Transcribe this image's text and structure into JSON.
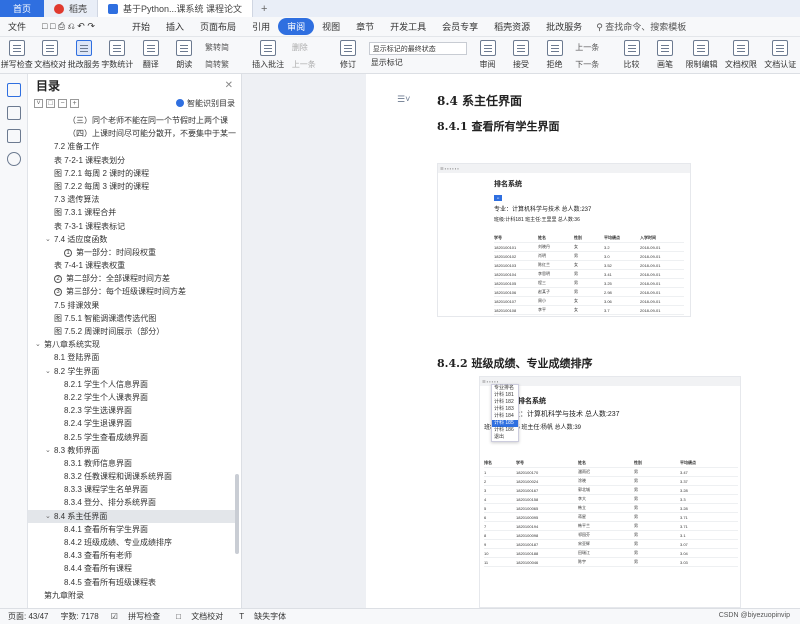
{
  "tabs": {
    "home": "首页",
    "t1": "稻壳",
    "t2": "基于Python...课系统 课程论文",
    "plus": "+"
  },
  "menu": [
    "开始",
    "插入",
    "页面布局",
    "引用",
    "审阅",
    "视图",
    "章节",
    "开发工具",
    "会员专享",
    "稻壳资源",
    "批改服务"
  ],
  "menu_file": "文件",
  "menu_selected_index": 4,
  "menu_search": "查找命令、搜索模板",
  "ribbon": {
    "buttons": [
      "拼写检查",
      "文档校对",
      "批改服务",
      "字数统计",
      "翻译",
      "朗读"
    ],
    "convert": [
      "繁转简",
      "简转繁"
    ],
    "insert_comment": "插入批注",
    "comment_ops": [
      "删除",
      "上一条",
      "下一条"
    ],
    "revise": "修订",
    "state_select": "显示标记的最终状态",
    "show_marks": "显示标记",
    "review": "审阅",
    "accept": "接受",
    "reject": "拒绝",
    "prev": "上一条",
    "next": "下一条",
    "compare": "比较",
    "pen": "画笔",
    "restrict": "限制编辑",
    "permission": "文档权限",
    "auth": "文档认证"
  },
  "toc": {
    "title": "目录",
    "smart": "智能识别目录",
    "items": [
      {
        "t": "（三）同个老师不能在同一个节假时上两个课​",
        "lvl": 3,
        "sel": false
      },
      {
        "t": "（四）上课时间尽可能分散开，不要集中于某一...",
        "lvl": 3,
        "sel": false
      },
      {
        "t": "7.2  准备工作",
        "lvl": 1,
        "sel": false
      },
      {
        "t": "表 7-2-1  课程表划分",
        "lvl": 1,
        "sel": false
      },
      {
        "t": "图 7.2.1  每周 2 课时的课程",
        "lvl": 1,
        "sel": false
      },
      {
        "t": "图 7.2.2  每周 3 课时的课程",
        "lvl": 1,
        "sel": false
      },
      {
        "t": "7.3  遗传算法",
        "lvl": 1,
        "sel": false
      },
      {
        "t": "图 7.3.1  课程合并",
        "lvl": 1,
        "sel": false
      },
      {
        "t": "表 7-3-1  课程表标记",
        "lvl": 1,
        "sel": false
      },
      {
        "t": "7.4  适应度函数",
        "lvl": 1,
        "sel": false,
        "arrow": "v"
      },
      {
        "t": "第一部分：时间段权重",
        "lvl": 2,
        "sel": false,
        "circ": "1"
      },
      {
        "t": "表 7-4-1  课程表权重",
        "lvl": 1,
        "sel": false
      },
      {
        "t": "第二部分：全部课程时间方差",
        "lvl": 1,
        "sel": false,
        "circ": "2"
      },
      {
        "t": "第三部分：每个班级课程时间方差",
        "lvl": 1,
        "sel": false,
        "circ": "3"
      },
      {
        "t": "7.5  排课效果",
        "lvl": 1,
        "sel": false
      },
      {
        "t": "图 7.5.1  智能调课遗传选代图",
        "lvl": 1,
        "sel": false
      },
      {
        "t": "图 7.5.2  周课时间展示（部分）",
        "lvl": 1,
        "sel": false
      },
      {
        "t": "第八章系统实现",
        "lvl": 0,
        "sel": false,
        "arrow": "v"
      },
      {
        "t": "8.1  登陆界面",
        "lvl": 1,
        "sel": false
      },
      {
        "t": "8.2  学生界面",
        "lvl": 1,
        "sel": false,
        "arrow": "v"
      },
      {
        "t": "8.2.1  学生个人信息界面",
        "lvl": 2,
        "sel": false
      },
      {
        "t": "8.2.2  学生个人课表界面",
        "lvl": 2,
        "sel": false
      },
      {
        "t": "8.2.3  学生选课界面",
        "lvl": 2,
        "sel": false
      },
      {
        "t": "8.2.4  学生退课界面",
        "lvl": 2,
        "sel": false
      },
      {
        "t": "8.2.5  学生查看成绩界面",
        "lvl": 2,
        "sel": false
      },
      {
        "t": "8.3  教师界面",
        "lvl": 1,
        "sel": false,
        "arrow": "v"
      },
      {
        "t": "8.3.1  教师信息界面",
        "lvl": 2,
        "sel": false
      },
      {
        "t": "8.3.2  任教课程和调课系统界面",
        "lvl": 2,
        "sel": false
      },
      {
        "t": "8.3.3  课程学生名单界面",
        "lvl": 2,
        "sel": false
      },
      {
        "t": "8.3.4  登分、排分系统界面",
        "lvl": 2,
        "sel": false
      },
      {
        "t": "8.4  系主任界面",
        "lvl": 1,
        "sel": true,
        "arrow": "v"
      },
      {
        "t": "8.4.1  查看所有学生界面",
        "lvl": 2,
        "sel": false
      },
      {
        "t": "8.4.2  班级成绩、专业成绩排序",
        "lvl": 2,
        "sel": false
      },
      {
        "t": "8.4.3  查看所有老师",
        "lvl": 2,
        "sel": false
      },
      {
        "t": "8.4.4  查看所有课程",
        "lvl": 2,
        "sel": false
      },
      {
        "t": "8.4.5  查看所有班级课程表",
        "lvl": 2,
        "sel": false
      },
      {
        "t": "第九章附录",
        "lvl": 0,
        "sel": false
      }
    ]
  },
  "doc": {
    "h_84": "8.4  系主任界面",
    "h_841": "8.4.1  查看所有学生界面",
    "h_842": "8.4.2  班级成绩、专业成绩排序",
    "shot1": {
      "title": "排名系统",
      "major": "专业：计算机科学与技术 总人数:237",
      "cls": "班级:计科181 班主任:王里里 总人数:36",
      "headers": [
        "学号",
        "姓名",
        "性别",
        "平均绩点",
        "入学时间"
      ],
      "rows": [
        [
          "1820100101",
          "刘晓丹",
          "女",
          "3.2",
          "2018-09-01"
        ],
        [
          "1820100102",
          "肖明",
          "男",
          "3.0",
          "2018-09-01"
        ],
        [
          "1820100103",
          "陈红兰",
          "女",
          "3.52",
          "2018-09-01"
        ],
        [
          "1820100104",
          "李思明",
          "男",
          "3.41",
          "2018-09-01"
        ],
        [
          "1820100105",
          "程三",
          "男",
          "3.25",
          "2018-09-01"
        ],
        [
          "1820100106",
          "赵某子",
          "男",
          "2.98",
          "2018-09-01"
        ],
        [
          "1820100107",
          "周小",
          "女",
          "3.06",
          "2018-09-01"
        ],
        [
          "1820100108",
          "李平",
          "女",
          "3.7",
          "2018-09-01"
        ]
      ]
    },
    "shot2": {
      "title": "排名系统",
      "major": "专业：计算机科学与技术 总人数:237",
      "cls": "班级:计科185 班主任:杨帆 总人数:39",
      "headers": [
        "排名",
        "学号",
        "姓名",
        "性别",
        "平均绩点"
      ],
      "rows": [
        [
          "1",
          "1820100170",
          "潘雨迟",
          "男",
          "3.47"
        ],
        [
          "2",
          "1820100024",
          "涂晓",
          "男",
          "3.37"
        ],
        [
          "3",
          "1820100167",
          "郭北城",
          "男",
          "3.28"
        ],
        [
          "4",
          "1820100158",
          "李大",
          "男",
          "3.3"
        ],
        [
          "5",
          "1820100065",
          "韩立",
          "男",
          "3.28"
        ],
        [
          "6",
          "1820100095",
          "蒋星",
          "男",
          "3.71"
        ],
        [
          "7",
          "1820100194",
          "韩平兰",
          "男",
          "3.71"
        ],
        [
          "8",
          "1820100098",
          "祁园芬",
          "男",
          "3.1"
        ],
        [
          "9",
          "1820100187",
          "宋亚辉",
          "男",
          "3.07"
        ],
        [
          "10",
          "1820100188",
          "田瑞江",
          "男",
          "3.04"
        ],
        [
          "11",
          "1820100046",
          "陈宇",
          "男",
          "3.03"
        ]
      ],
      "dropdown": [
        "专业排名",
        "计科 181",
        "计科 182",
        "计科 183",
        "计科 184",
        "计科 185",
        "计科 186",
        "退出"
      ],
      "dropdown_selected": 5
    }
  },
  "status": {
    "page": "页面: 43/47",
    "words": "字数: 7178",
    "spell": "拼写检查",
    "proof": "文档校对",
    "font": "缺失字体"
  },
  "watermark": "CSDN @biyezuopinvip"
}
